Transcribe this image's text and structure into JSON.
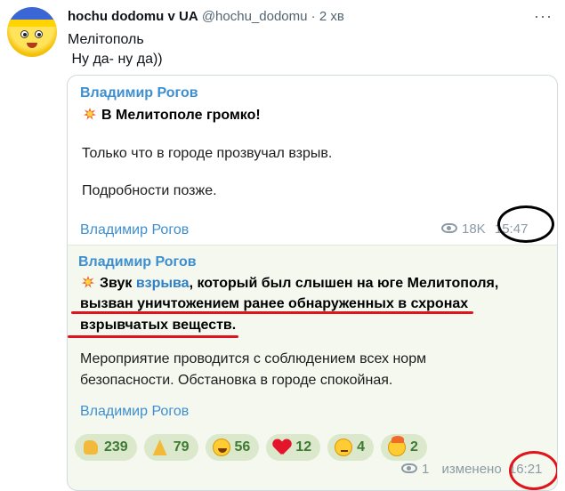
{
  "tweet": {
    "author_name": "hochu dodomu v UA",
    "author_handle": "@hochu_dodomu",
    "separator": "·",
    "time_ago": "2 хв",
    "text_lines": [
      "Мелітополь",
      " Ну да- ну да))"
    ]
  },
  "message1": {
    "channel": "Владимир Рогов",
    "headline": "В Мелитополе громко!",
    "body_1": "Только что в городе прозвучал взрыв.",
    "body_2": "Подробности позже.",
    "footer_name": "Владимир Рогов",
    "views": "18K",
    "time": "15:47"
  },
  "message2": {
    "channel": "Владимир Рогов",
    "headline_pre": "Звук ",
    "headline_link": "взрыва",
    "headline_post": ", который был слышен на юге Мелитополя,",
    "headline_line2": "вызван уничтожением ранее обнаруженных в схронах",
    "headline_line3": "взрывчатых веществ.",
    "body_line1": "Мероприятие проводится с соблюдением всех норм",
    "body_line2": "безопасности. Обстановка в городе спокойная.",
    "footer_name": "Владимир Рогов",
    "views": "1",
    "edited_label": "изменено",
    "time": "16:21",
    "reactions": [
      {
        "icon": "thumbs-up-icon",
        "count": "239"
      },
      {
        "icon": "praying-hands-icon",
        "count": "79"
      },
      {
        "icon": "grinning-face-icon",
        "count": "56"
      },
      {
        "icon": "red-heart-icon",
        "count": "12"
      },
      {
        "icon": "thinking-face-icon",
        "count": "4"
      },
      {
        "icon": "exploding-head-icon",
        "count": "2"
      }
    ]
  },
  "colors": {
    "channel_blue": "#3d8fcf",
    "reaction_bg": "#dbe8cb",
    "annotation_red": "#e0141c",
    "annotation_black": "#000000"
  }
}
